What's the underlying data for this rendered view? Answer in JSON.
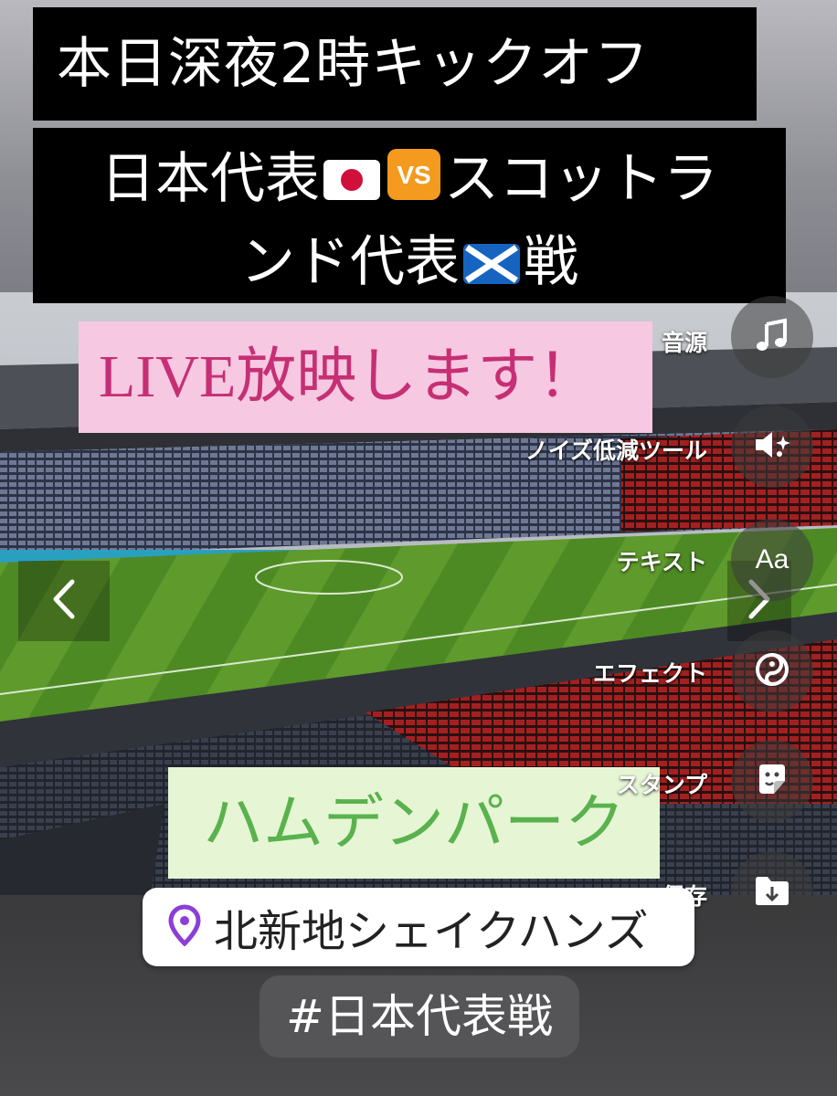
{
  "overlay": {
    "headline_1": "本日深夜2時キックオフ",
    "match_line_1_a": "日本代表",
    "match_line_1_b": "スコットラ",
    "match_line_2_a": "ンド代表",
    "match_line_2_b": "戦",
    "live_text": "LIVE放映します！",
    "stadium_text": "ハムデンパーク"
  },
  "location_sticker": {
    "text": "北新地シェイクハンズ",
    "icon": "location-pin-icon"
  },
  "hashtag_sticker": {
    "text": "#日本代表戦"
  },
  "toolbar": {
    "items": [
      {
        "label": "音源",
        "icon": "music-note-icon"
      },
      {
        "label": "ノイズ低減ツール",
        "icon": "noise-reduction-icon"
      },
      {
        "label": "テキスト",
        "icon": "text-aa-icon",
        "glyph": "Aa"
      },
      {
        "label": "エフェクト",
        "icon": "effect-icon"
      },
      {
        "label": "スタンプ",
        "icon": "sticker-icon"
      },
      {
        "label": "保存",
        "icon": "save-download-icon"
      }
    ]
  },
  "navigation": {
    "prev_icon": "chevron-left-icon",
    "next_icon": "chevron-right-icon"
  },
  "colors": {
    "live_bg": "#f7c8e2",
    "live_text": "#c62f74",
    "stadium_bg": "#e6f6d4",
    "stadium_text": "#5ab24e",
    "location_pin": "#8b3fd6"
  }
}
